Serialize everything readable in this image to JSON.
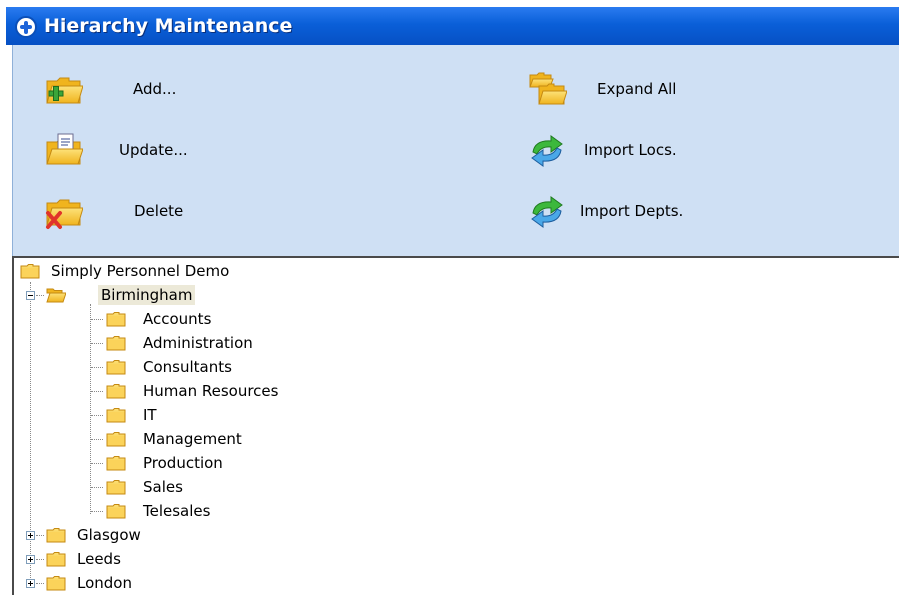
{
  "window": {
    "title": "Hierarchy Maintenance"
  },
  "toolbar": {
    "add_label": "Add...",
    "update_label": "Update...",
    "delete_label": "Delete",
    "expand_all_label": "Expand All",
    "import_locs_label": "Import Locs.",
    "import_depts_label": "Import Depts."
  },
  "tree": {
    "root": "Simply Personnel Demo",
    "expanded": {
      "label": "Birmingham",
      "children": [
        "Accounts",
        "Administration",
        "Consultants",
        "Human Resources",
        "IT",
        "Management",
        "Production",
        "Sales",
        "Telesales"
      ]
    },
    "collapsed": [
      "Glasgow",
      "Leeds",
      "London"
    ]
  },
  "colors": {
    "title_bar": "#0a5fd8",
    "toolbar_bg": "#cfe0f4",
    "folder": "#f5c842",
    "selection": "#ece9d8"
  }
}
